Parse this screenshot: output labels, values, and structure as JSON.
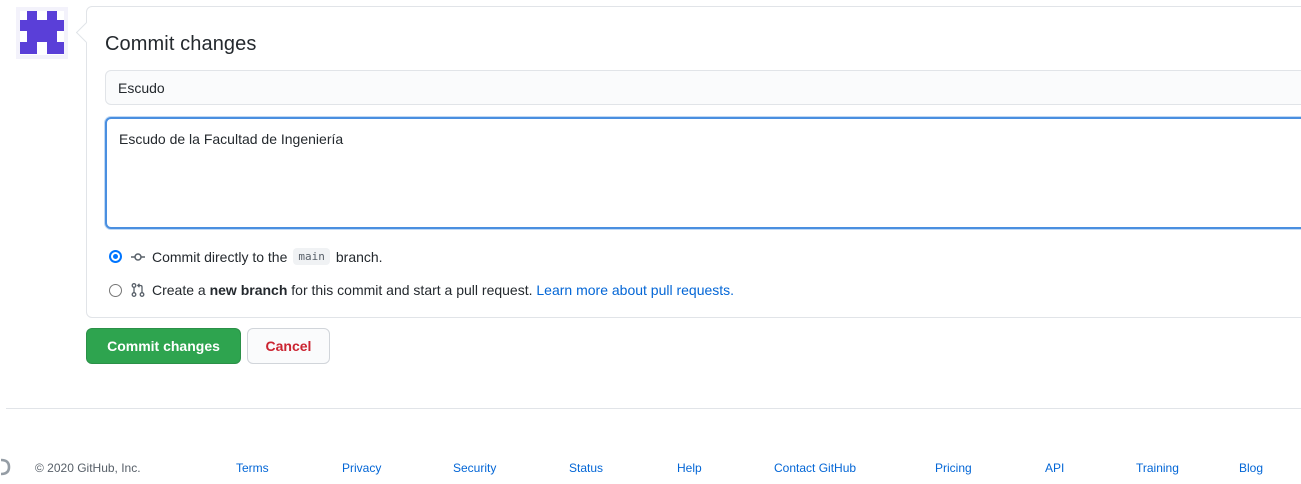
{
  "commit_form": {
    "title": "Commit changes",
    "summary_value": "Escudo",
    "description_value": "Escudo de la Facultad de Ingeniería",
    "option_direct": {
      "prefix": "Commit directly to the",
      "branch": "main",
      "suffix": "branch.",
      "icon": "git-commit-icon",
      "selected": true
    },
    "option_new_branch": {
      "prefix": "Create a",
      "bold": "new branch",
      "middle": "for this commit and start a pull request.",
      "link": "Learn more about pull requests.",
      "icon": "git-pull-request-icon",
      "selected": false
    },
    "commit_button": "Commit changes",
    "cancel_button": "Cancel"
  },
  "footer": {
    "copyright": "© 2020 GitHub, Inc.",
    "links": [
      "Terms",
      "Privacy",
      "Security",
      "Status",
      "Help",
      "Contact GitHub",
      "Pricing",
      "API",
      "Training",
      "Blog"
    ]
  },
  "colors": {
    "primary_button": "#2ea44f",
    "danger_text": "#cb2431",
    "link": "#0366d6",
    "focus_border": "#4a8fe0",
    "avatar": "#5a3fd8"
  }
}
